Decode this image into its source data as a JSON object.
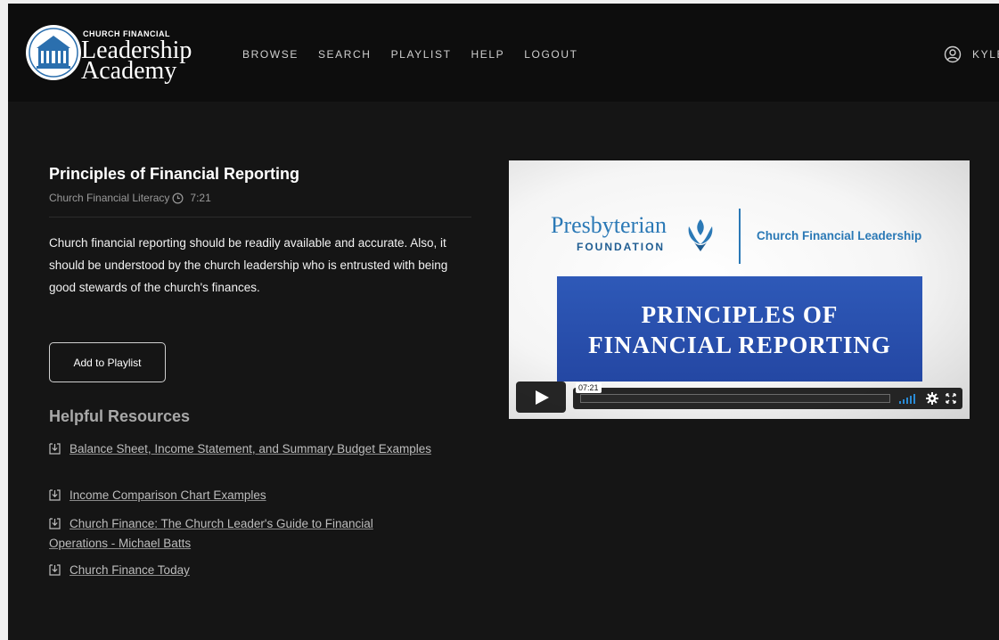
{
  "brand": {
    "small": "CHURCH FINANCIAL",
    "line1": "Leadership",
    "line2": "Academy",
    "logo_icon": "church-building-icon"
  },
  "nav": [
    "BROWSE",
    "SEARCH",
    "PLAYLIST",
    "HELP",
    "LOGOUT"
  ],
  "user": {
    "name": "KYLE",
    "icon": "user-circle-icon"
  },
  "lesson": {
    "title": "Principles of Financial Reporting",
    "category": "Church Financial Literacy",
    "duration": "7:21",
    "description": "Church financial reporting should be readily available and accurate. Also, it should be understood by the church leadership who is entrusted with being good stewards of the church's finances.",
    "add_button": "Add to Playlist"
  },
  "resources": {
    "heading": "Helpful Resources",
    "items": [
      "Balance Sheet, Income Statement, and Summary Budget Examples",
      "Income Comparison Chart Examples",
      "Church Finance: The Church Leader's Guide to Financial Operations - Michael Batts",
      "Church Finance Today"
    ]
  },
  "video": {
    "org_name": "Presbyterian",
    "org_sub": "FOUNDATION",
    "program": "Church Financial Leadership",
    "banner_line1": "PRINCIPLES OF",
    "banner_line2": "FINANCIAL REPORTING",
    "time_tooltip": "07:21",
    "progress": 0
  },
  "colors": {
    "accent_blue": "#2b79b6",
    "banner_blue": "#2a52b0",
    "volume_blue": "#2a8ad4"
  }
}
